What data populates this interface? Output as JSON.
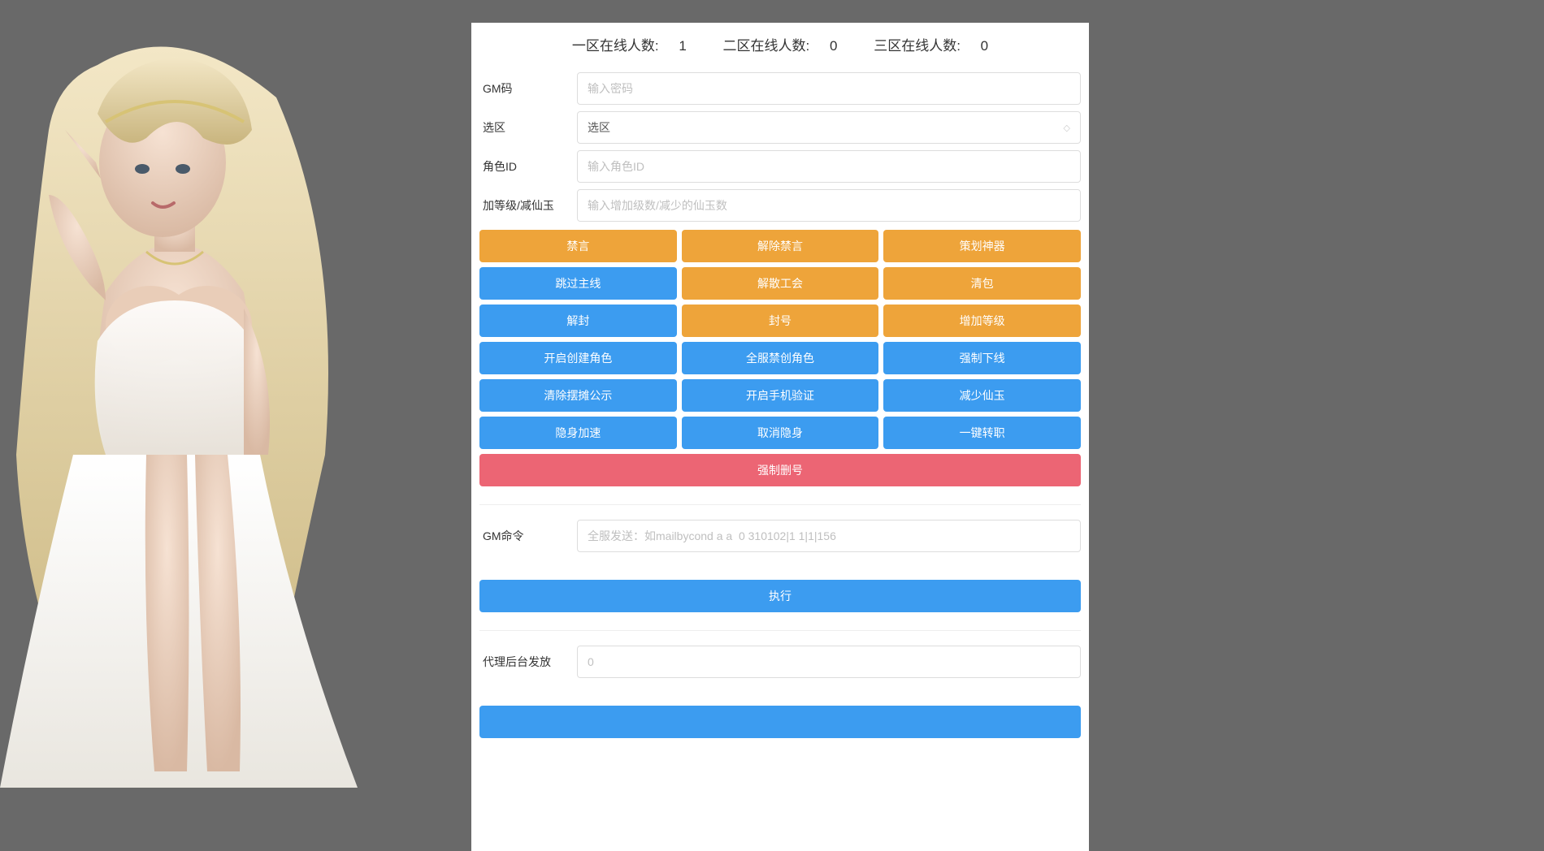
{
  "status": {
    "zone1_label": "一区在线人数:",
    "zone1_count": "1",
    "zone2_label": "二区在线人数:",
    "zone2_count": "0",
    "zone3_label": "三区在线人数:",
    "zone3_count": "0"
  },
  "fields": {
    "gm_code": {
      "label": "GM码",
      "placeholder": "输入密码"
    },
    "zone": {
      "label": "选区",
      "selected": "选区"
    },
    "role_id": {
      "label": "角色ID",
      "placeholder": "输入角色ID"
    },
    "level": {
      "label": "加等级/减仙玉",
      "placeholder": "输入增加级数/减少的仙玉数"
    },
    "gm_cmd": {
      "label": "GM命令",
      "placeholder": "全服发送：如mailbycond a a  0 310102|1 1|1|156"
    },
    "proxy": {
      "label": "代理后台发放",
      "placeholder": "0"
    }
  },
  "buttons": {
    "row1": {
      "a": "禁言",
      "b": "解除禁言",
      "c": "策划神器"
    },
    "row2": {
      "a": "跳过主线",
      "b": "解散工会",
      "c": "清包"
    },
    "row3": {
      "a": "解封",
      "b": "封号",
      "c": "增加等级"
    },
    "row4": {
      "a": "开启创建角色",
      "b": "全服禁创角色",
      "c": "强制下线"
    },
    "row5": {
      "a": "清除摆摊公示",
      "b": "开启手机验证",
      "c": "减少仙玉"
    },
    "row6": {
      "a": "隐身加速",
      "b": "取消隐身",
      "c": "一键转职"
    },
    "force_del": "强制删号",
    "execute": "执行"
  }
}
